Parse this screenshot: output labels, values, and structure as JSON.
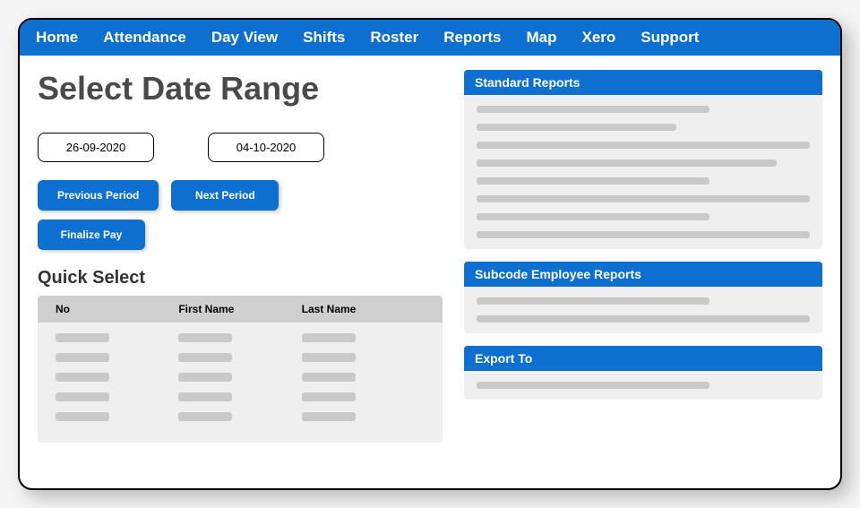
{
  "nav": {
    "items": [
      "Home",
      "Attendance",
      "Day View",
      "Shifts",
      "Roster",
      "Reports",
      "Map",
      "Xero",
      "Support"
    ]
  },
  "page": {
    "title": "Select Date Range"
  },
  "dates": {
    "start": "26-09-2020",
    "end": "04-10-2020"
  },
  "buttons": {
    "previous": "Previous Period",
    "next": "Next Period",
    "finalize": "Finalize Pay"
  },
  "quickSelect": {
    "title": "Quick Select",
    "columns": {
      "no": "No",
      "first": "First Name",
      "last": "Last Name"
    }
  },
  "panels": {
    "standard": "Standard Reports",
    "subcode": "Subcode Employee Reports",
    "export": "Export To"
  }
}
